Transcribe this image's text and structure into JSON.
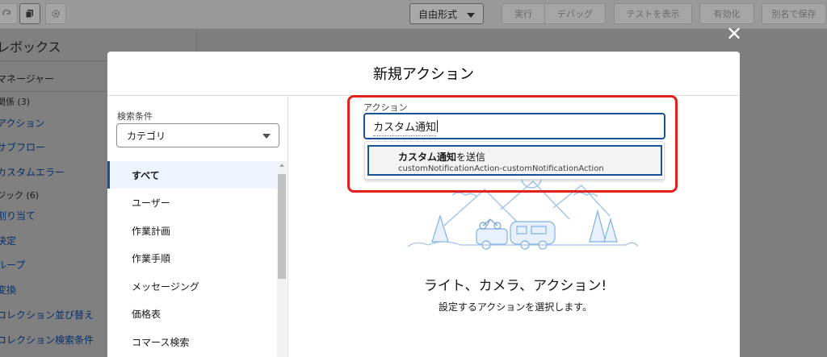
{
  "toolbar": {
    "mode_select": "自由形式",
    "run_label": "実行",
    "debug_label": "デバッグ",
    "view_tests_label": "テストを表示",
    "activate_label": "有効化",
    "save_as_label": "別名で保存"
  },
  "left_panel": {
    "title": "レボックス",
    "manager_label": "マネージャー",
    "items": [
      {
        "label": "関係 (3)",
        "kind": "group"
      },
      {
        "label": "アクション",
        "kind": "link"
      },
      {
        "label": "サブフロー",
        "kind": "link"
      },
      {
        "label": "カスタムエラー",
        "kind": "link"
      },
      {
        "label": "ジック (6)",
        "kind": "group"
      },
      {
        "label": "割り当て",
        "kind": "link"
      },
      {
        "label": "決定",
        "kind": "link"
      },
      {
        "label": "ループ",
        "kind": "link"
      },
      {
        "label": "変換",
        "kind": "link"
      },
      {
        "label": "コレクション並び替え",
        "kind": "link"
      },
      {
        "label": "コレクション検索条件",
        "kind": "link"
      }
    ]
  },
  "modal": {
    "title": "新規アクション",
    "filter_label": "検索条件",
    "filter_value": "カテゴリ",
    "categories": [
      {
        "label": "すべて",
        "active": true
      },
      {
        "label": "ユーザー",
        "active": false
      },
      {
        "label": "作業計画",
        "active": false
      },
      {
        "label": "作業手順",
        "active": false
      },
      {
        "label": "メッセージング",
        "active": false
      },
      {
        "label": "価格表",
        "active": false
      },
      {
        "label": "コマース検索",
        "active": false
      }
    ],
    "action_label": "アクション",
    "action_input_value": "カスタム通知",
    "suggestion": {
      "title_bold": "カスタム通知",
      "title_rest": "を送信",
      "subtitle": "customNotificationAction-customNotificationAction"
    },
    "empty_title": "ライト、カメラ、アクション!",
    "empty_subtitle": "設定するアクションを選択します。"
  },
  "colors": {
    "accent": "#1b5297",
    "highlight": "#e1211c",
    "overlay": "#7f7f7f"
  }
}
